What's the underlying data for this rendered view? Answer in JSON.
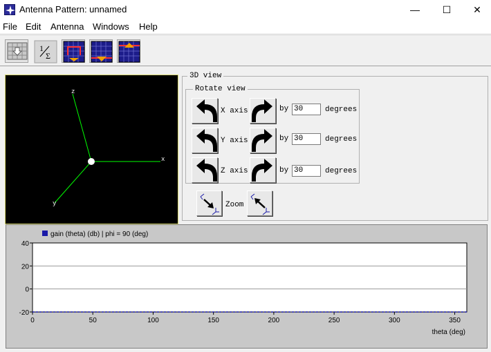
{
  "window": {
    "title": "Antenna Pattern: unnamed",
    "minimize_glyph": "—",
    "maximize_glyph": "☐",
    "close_glyph": "✕"
  },
  "menu": [
    "File",
    "Edit",
    "Antenna",
    "Windows",
    "Help"
  ],
  "toolbar": {
    "icons": [
      "grid-import-icon",
      "fraction-sum-icon",
      "pattern-grid-red-icon",
      "pattern-grid-down-icon",
      "pattern-grid-up-icon"
    ],
    "fraction_label": "1/Σ"
  },
  "view3d": {
    "axes": [
      "x",
      "y",
      "z"
    ]
  },
  "controls": {
    "group_title": "3D view",
    "rotate_title": "Rotate view",
    "rows": [
      {
        "axis_label": "X axis",
        "by_label": "by",
        "value": "30",
        "unit": "degrees"
      },
      {
        "axis_label": "Y axis",
        "by_label": "by",
        "value": "30",
        "unit": "degrees"
      },
      {
        "axis_label": "Z axis",
        "by_label": "by",
        "value": "30",
        "unit": "degrees"
      }
    ],
    "zoom_label": "Zoom"
  },
  "colors": {
    "series": "#1a1aa8",
    "axis_line": "#00ff00",
    "view_bg": "#000000"
  },
  "chart_data": {
    "type": "line",
    "legend": "gain (theta) (db) | phi = 90 (deg)",
    "xlabel": "theta (deg)",
    "ylabel": "",
    "xlim": [
      0,
      360
    ],
    "ylim": [
      -20,
      40
    ],
    "xticks": [
      0,
      50,
      100,
      150,
      200,
      250,
      300,
      350
    ],
    "yticks": [
      40,
      20,
      0,
      -20
    ],
    "grid": true,
    "series": [
      {
        "name": "gain (theta) (db) | phi = 90 (deg)",
        "x": [
          0,
          360
        ],
        "y": [
          -20,
          -20
        ]
      }
    ]
  }
}
